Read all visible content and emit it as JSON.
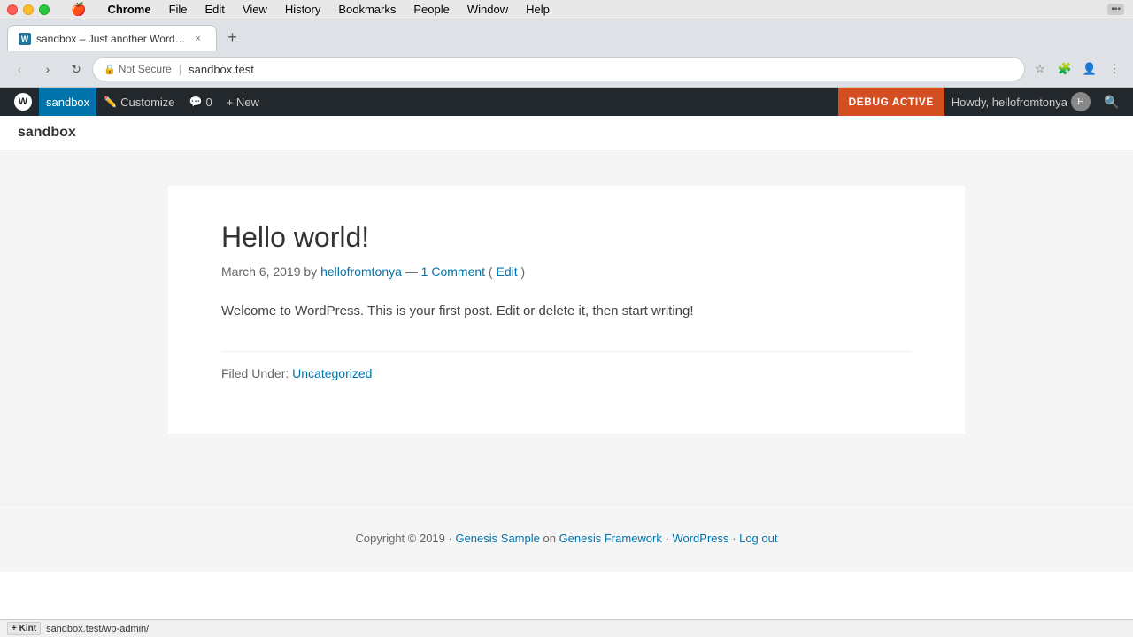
{
  "titlebar": {
    "menu_items": [
      "",
      "Chrome",
      "File",
      "Edit",
      "View",
      "History",
      "Bookmarks",
      "People",
      "Window",
      "Help"
    ]
  },
  "tab": {
    "title": "sandbox – Just another Word…",
    "favicon_text": "W",
    "close_label": "×"
  },
  "addressbar": {
    "back_label": "‹",
    "forward_label": "›",
    "refresh_label": "↻",
    "not_secure": "Not Secure",
    "url": "sandbox.test",
    "new_tab_label": "+"
  },
  "wp_admin_bar": {
    "wp_logo": "W",
    "sandbox_label": "sandbox",
    "customize_label": "Customize",
    "comments_label": "0",
    "new_label": "+ New",
    "debug_label": "DEBUG ACTIVE",
    "howdy_label": "Howdy, hellofromtonya",
    "search_label": "🔍"
  },
  "site": {
    "title": "sandbox",
    "post": {
      "title": "Hello world!",
      "meta": "March 6, 2019 by ",
      "author": "hellofromtonya",
      "separator": "—",
      "comment_link": "1 Comment",
      "edit_link": "Edit",
      "content": "Welcome to WordPress. This is your first post. Edit or delete it, then start writing!",
      "filed_under": "Filed Under:",
      "category_link": "Uncategorized"
    },
    "footer": {
      "copyright": "Copyright © 2019 ·",
      "genesis_sample_link": "Genesis Sample",
      "on_text": "on",
      "genesis_framework_link": "Genesis Framework",
      "sep1": "·",
      "wordpress_link": "WordPress",
      "sep2": "·",
      "logout_link": "Log out"
    }
  },
  "statusbar": {
    "kint_label": "+ Kint",
    "url": "sandbox.test/wp-admin/"
  }
}
